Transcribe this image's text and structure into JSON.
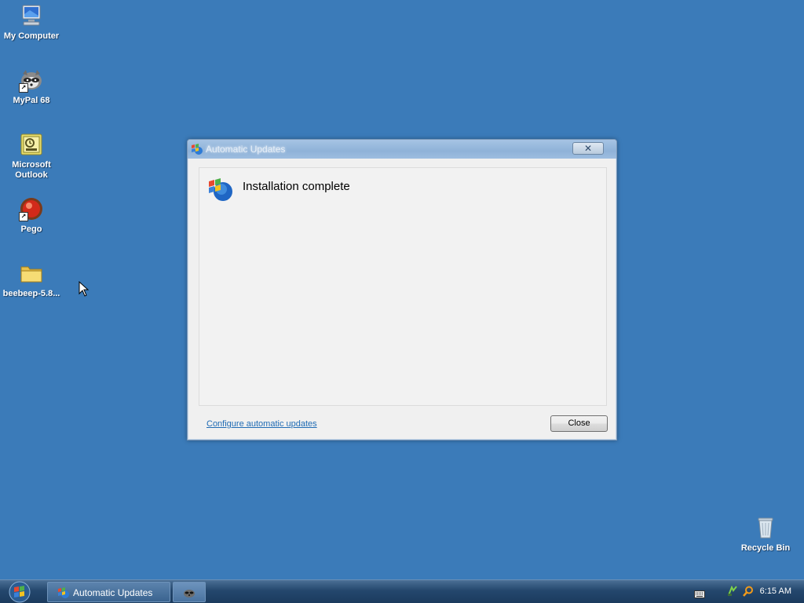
{
  "desktop": {
    "icons": [
      {
        "label": "My Computer",
        "icon": "computer-icon"
      },
      {
        "label": "MyPal 68",
        "icon": "raccoon-browser-icon"
      },
      {
        "label": "Microsoft Outlook",
        "icon": "outlook-icon"
      },
      {
        "label": "Pego",
        "icon": "pego-icon"
      },
      {
        "label": "beebeep-5.8...",
        "icon": "folder-icon"
      },
      {
        "label": "Recycle Bin",
        "icon": "recycle-bin-icon"
      }
    ]
  },
  "dialog": {
    "title": "Automatic Updates",
    "close_glyph": "✕",
    "heading": "Installation complete",
    "link": "Configure automatic updates",
    "close_button": "Close"
  },
  "taskbar": {
    "start_icon": "windows-logo-icon",
    "buttons": [
      {
        "label": "Automatic Updates",
        "icon": "windows-update-icon"
      },
      {
        "label": "",
        "icon": "raccoon-icon"
      }
    ],
    "tray": {
      "icons": [
        "keyboard-icon",
        "network-icon",
        "search-icon"
      ],
      "clock": "6:15 AM"
    }
  },
  "colors": {
    "desktop_bg": "#3b7bb9",
    "link": "#1f6bb4"
  }
}
